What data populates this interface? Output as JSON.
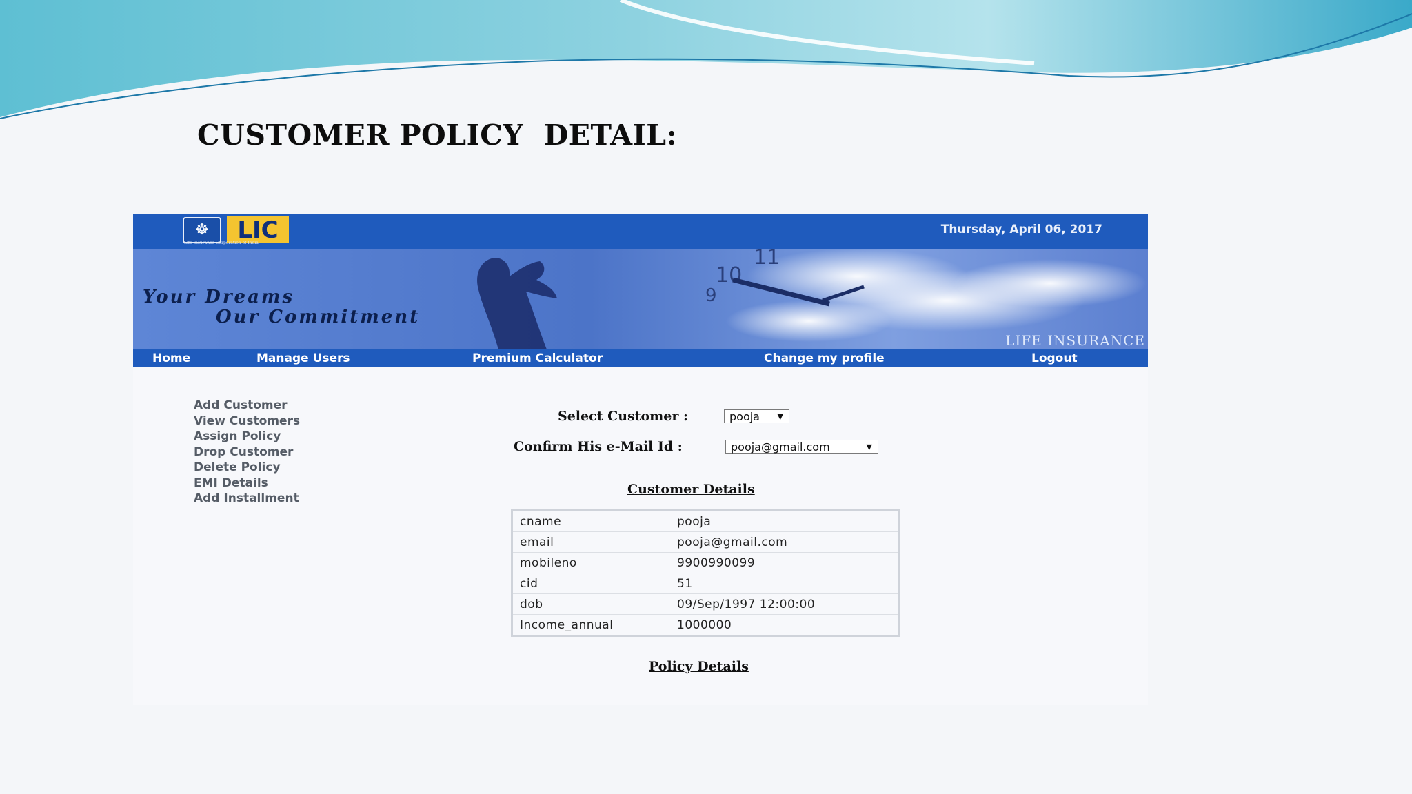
{
  "slide": {
    "title": "CUSTOMER POLICY  DETAIL:"
  },
  "app": {
    "logo_text": "LIC",
    "logo_sub": "Life Insurance Corporation of India",
    "date": "Thursday, April 06, 2017",
    "banner": {
      "tagline_1": "Your Dreams",
      "tagline_2": "Our Commitment",
      "brand": "LIFE INSURANCE"
    },
    "nav": [
      "Home",
      "Manage Users",
      "Premium Calculator",
      "Change my profile",
      "Logout"
    ],
    "sidebar": [
      "Add Customer",
      "View Customers",
      "Assign Policy",
      "Drop Customer",
      "Delete Policy",
      "EMI Details",
      "Add Installment"
    ],
    "form": {
      "select_customer_label": "Select Customer :",
      "select_customer_value": "pooja",
      "confirm_email_label": "Confirm His e-Mail Id :",
      "confirm_email_value": "pooja@gmail.com"
    },
    "customer_details": {
      "heading": "Customer Details",
      "rows": [
        [
          "cname",
          "pooja"
        ],
        [
          "email",
          "pooja@gmail.com"
        ],
        [
          "mobileno",
          "9900990099"
        ],
        [
          "cid",
          "51"
        ],
        [
          "dob",
          "09/Sep/1997 12:00:00"
        ],
        [
          "Income_annual",
          "1000000"
        ]
      ]
    },
    "policy_details": {
      "heading": "Policy Details"
    }
  },
  "colors": {
    "nav_blue": "#1f5bbd",
    "logo_yellow": "#f4c430",
    "wave_teal": "#6fc3d6"
  }
}
